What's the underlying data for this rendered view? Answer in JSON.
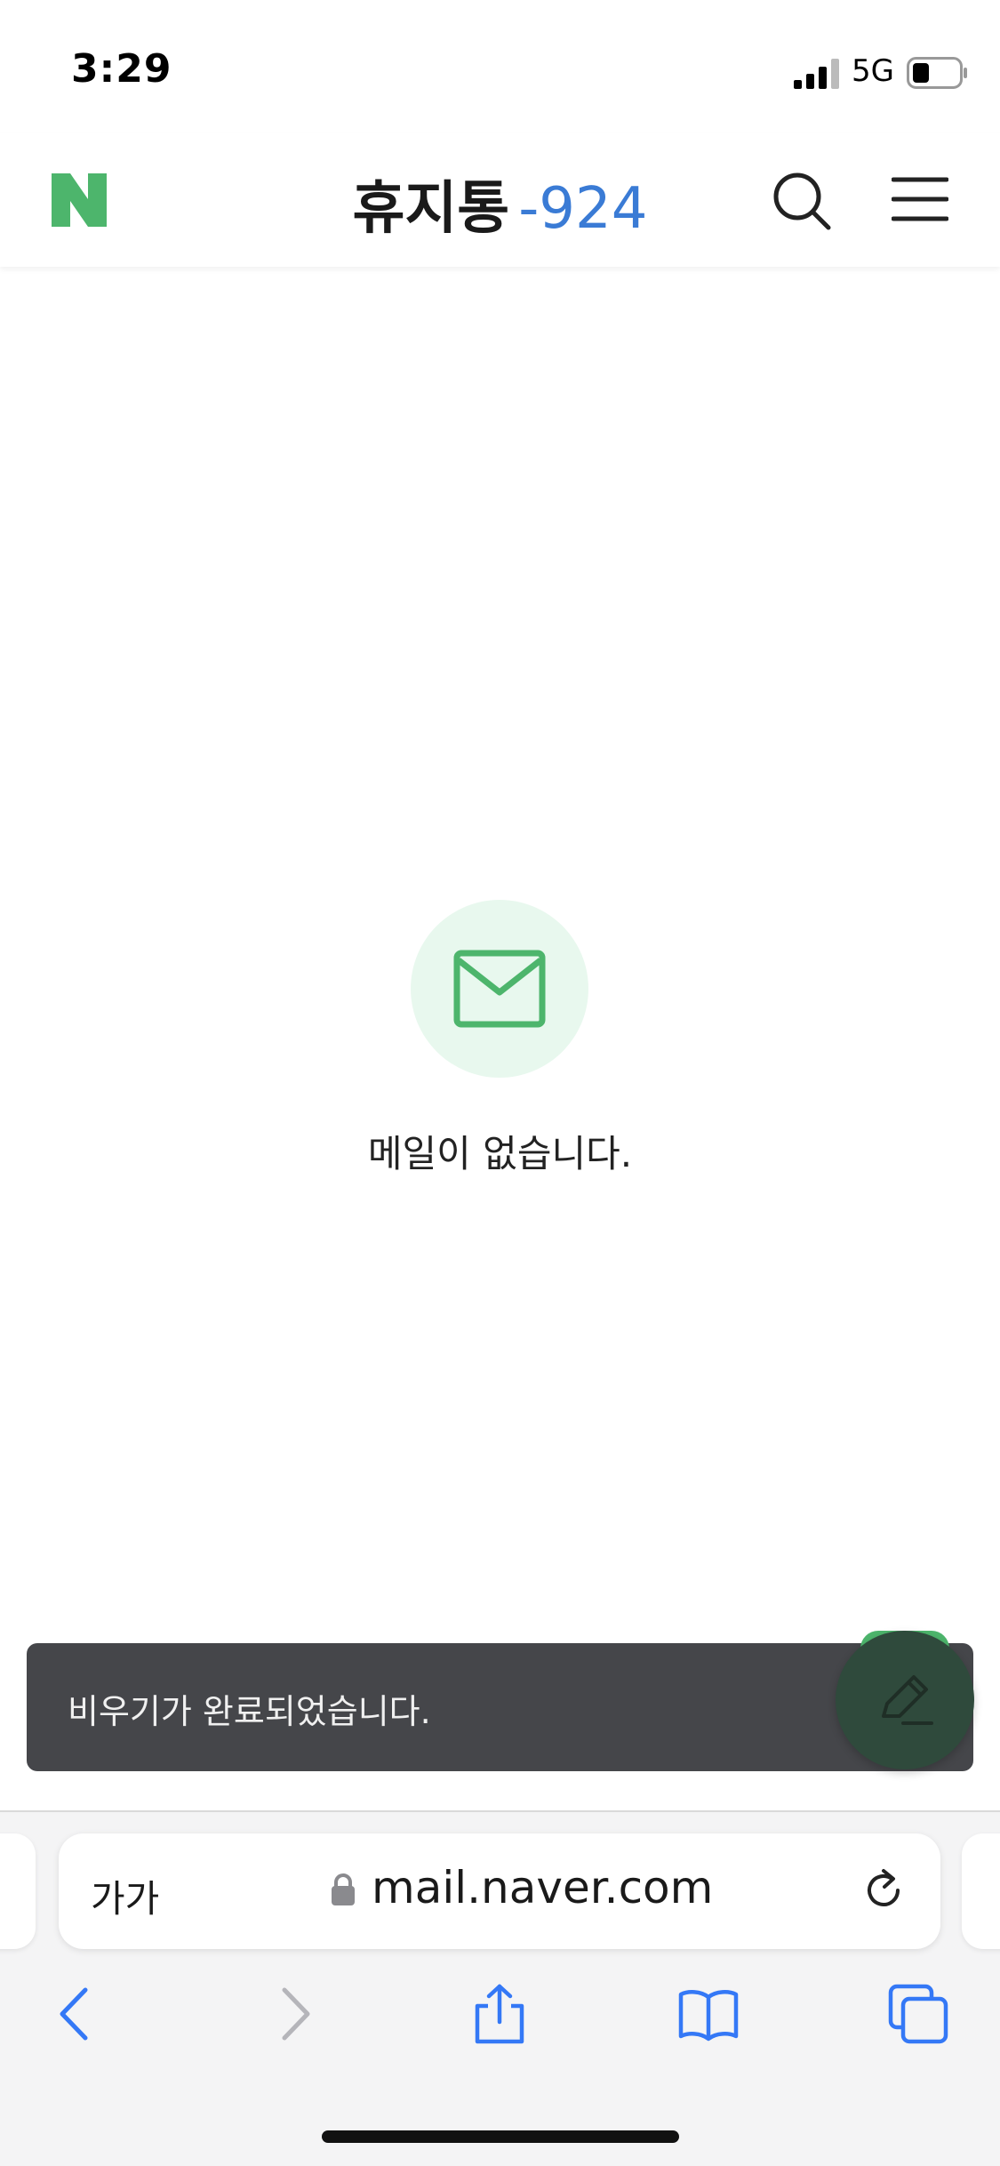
{
  "status_bar": {
    "time": "3:29",
    "network": "5G"
  },
  "header": {
    "title": "휴지통",
    "count": "-924"
  },
  "empty_state": {
    "message": "메일이 없습니다."
  },
  "toast": {
    "message": "비우기가 완료되었습니다."
  },
  "browser": {
    "text_size_label": "가가",
    "url": "mail.naver.com"
  },
  "colors": {
    "brand_green": "#4db56c",
    "count_blue": "#3a7bd5",
    "safari_blue": "#3478f6"
  },
  "icons": [
    "naver-logo",
    "search-icon",
    "menu-icon",
    "mail-icon",
    "pencil-icon",
    "lock-icon",
    "reload-icon",
    "back-icon",
    "forward-icon",
    "share-icon",
    "bookmarks-icon",
    "tabs-icon"
  ]
}
